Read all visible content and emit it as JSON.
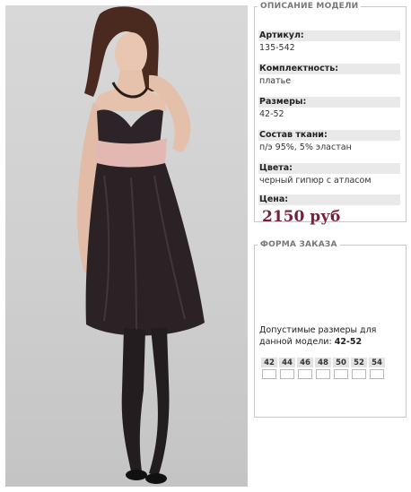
{
  "description": {
    "legend": "ОПИСАНИЕ МОДЕЛИ",
    "fields": [
      {
        "label": "Артикул:",
        "value": "135-542"
      },
      {
        "label": "Комплектность:",
        "value": "платье"
      },
      {
        "label": "Размеры:",
        "value": "42-52"
      },
      {
        "label": "Состав ткани:",
        "value": "п/э 95%, 5% эластан"
      },
      {
        "label": "Цвета:",
        "value": "черный гипюр с атласом"
      }
    ],
    "price_label": "Цена:",
    "price": "2150 руб"
  },
  "order": {
    "legend": "ФОРМА ЗАКАЗА",
    "allowed_text": "Допустимые размеры для данной модели:",
    "allowed_sizes": "42-52",
    "sizes": [
      "42",
      "44",
      "46",
      "48",
      "50",
      "52",
      "54"
    ]
  },
  "colors": {
    "price": "#7a1f3b",
    "label_bg": "#e9e9e9",
    "border": "#c8c8c8"
  }
}
